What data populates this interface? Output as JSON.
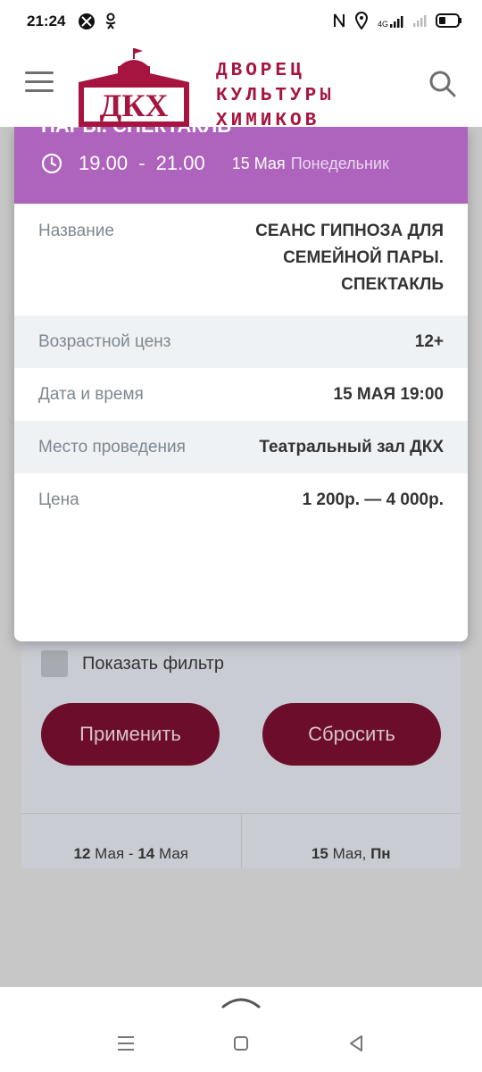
{
  "status_bar": {
    "time": "21:24",
    "left_icons": [
      "ball-icon",
      "odnoklassniki-icon"
    ],
    "right_icons": [
      "nfc-icon",
      "location-icon",
      "signal-4g-icon",
      "signal-icon",
      "battery-icon"
    ],
    "network_label": "4G"
  },
  "header": {
    "logo_abbr": "ДКХ",
    "logo_lines": [
      "ДВОРЕЦ",
      "КУЛЬТУРЫ",
      "ХИМИКОВ"
    ],
    "brand_color": "#a5153f"
  },
  "modal": {
    "title_clipped": "ПАРЫ. СПЕКТАКЛЬ",
    "time_start": "19.00",
    "time_sep": "-",
    "time_end": "21.00",
    "date": "15 Мая",
    "weekday": "Понедельник",
    "header_color": "#ae63bd",
    "rows": [
      {
        "label": "Название",
        "value_lines": [
          "СЕАНС ГИПНОЗА ДЛЯ",
          "СЕМЕЙНОЙ ПАРЫ.",
          "СПЕКТАКЛЬ"
        ]
      },
      {
        "label": "Возрастной ценз",
        "value": "12+"
      },
      {
        "label": "Дата и время",
        "value": "15 МАЯ 19:00"
      },
      {
        "label": "Место проведения",
        "value": "Театральный зал ДКХ"
      },
      {
        "label": "Цена",
        "value": "1 200р. — 4 000р."
      }
    ]
  },
  "background": {
    "show_filter_label": "Показать фильтр",
    "apply_label": "Применить",
    "reset_label": "Сбросить",
    "button_color": "#6b0d2b",
    "date_range": {
      "start_day": "12",
      "start_month": "Мая",
      "sep": "-",
      "end_day": "14",
      "end_month": "Мая"
    },
    "date_single": {
      "day": "15",
      "month": "Мая,",
      "weekday": "Пн"
    }
  }
}
